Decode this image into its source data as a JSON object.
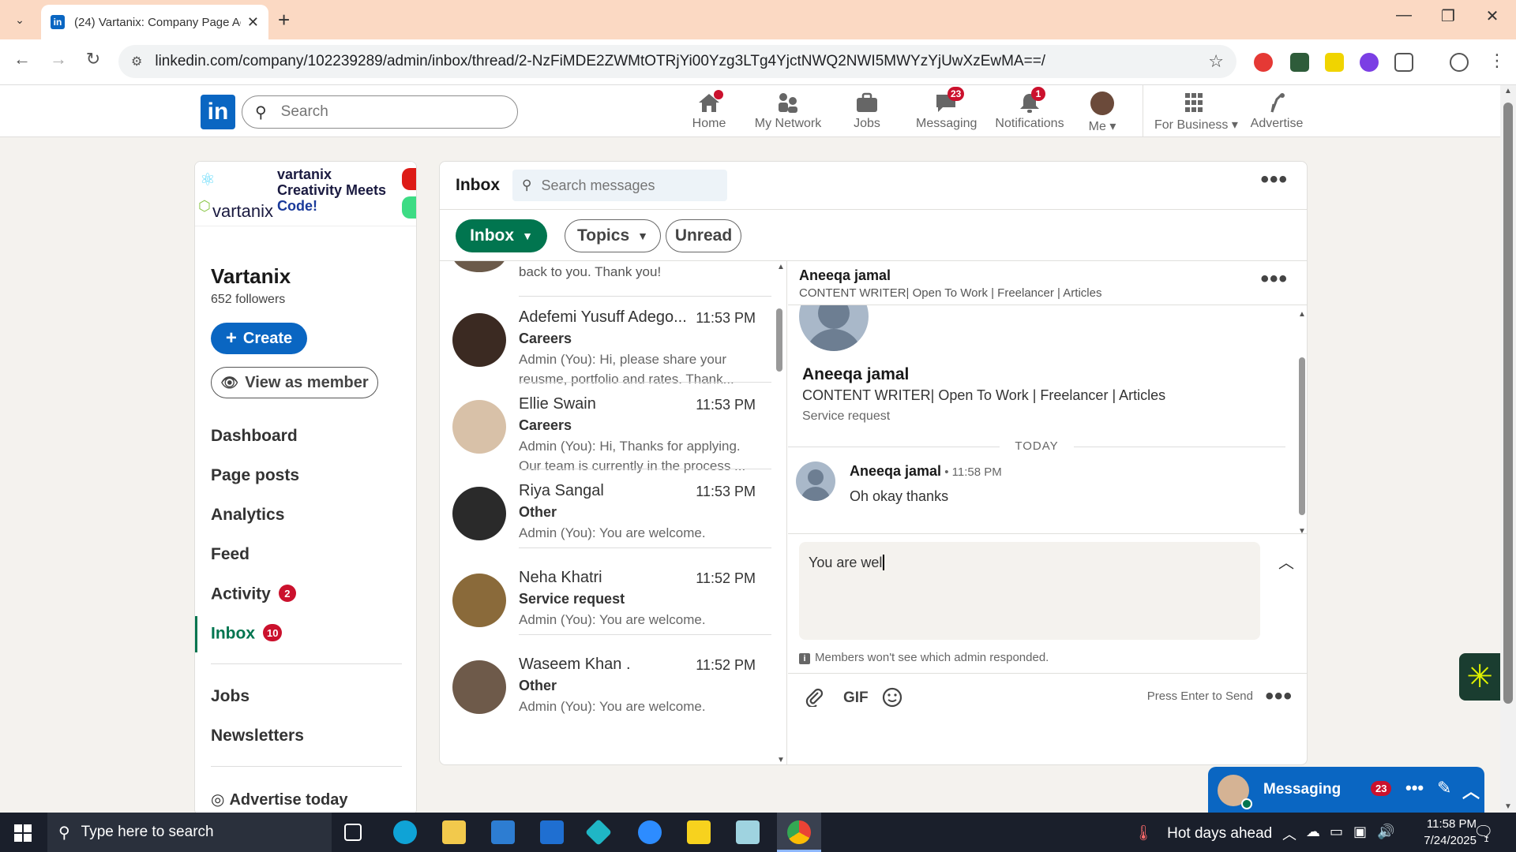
{
  "browser": {
    "tab_title": "(24) Vartanix: Company Page Ac",
    "url": "linkedin.com/company/102239289/admin/inbox/thread/2-NzFiMDE2ZWMtOTRjYi00Yzg3LTg4YjctNWQ2NWI5MWYzYjUwXzEwMA==/"
  },
  "li_nav": {
    "search_placeholder": "Search",
    "items": [
      {
        "label": "Home",
        "badge": ""
      },
      {
        "label": "My Network",
        "badge": ""
      },
      {
        "label": "Jobs",
        "badge": ""
      },
      {
        "label": "Messaging",
        "badge": "23"
      },
      {
        "label": "Notifications",
        "badge": "1"
      },
      {
        "label": "Me",
        "badge": ""
      },
      {
        "label": "For Business",
        "badge": ""
      },
      {
        "label": "Advertise",
        "badge": ""
      }
    ]
  },
  "page": {
    "cover_text_line1": "vartanix",
    "cover_text_line2": "Creativity Meets",
    "cover_text_line3": "Code!",
    "cover_logo": "vartanix",
    "name": "Vartanix",
    "followers": "652 followers",
    "create_label": "Create",
    "view_as_member_label": "View as member",
    "nav": {
      "dashboard": "Dashboard",
      "page_posts": "Page posts",
      "analytics": "Analytics",
      "feed": "Feed",
      "activity": "Activity",
      "activity_badge": "2",
      "inbox": "Inbox",
      "inbox_badge": "10",
      "jobs": "Jobs",
      "newsletters": "Newsletters",
      "advertise_today": "Advertise today"
    }
  },
  "inbox": {
    "title": "Inbox",
    "search_placeholder": "Search messages",
    "filters": {
      "inbox": "Inbox",
      "topics": "Topics",
      "unread": "Unread"
    },
    "partial_preview": "back to you. Thank you!",
    "conversations": [
      {
        "name": "Adefemi Yusuff Adego...",
        "time": "11:53 PM",
        "topic": "Careers",
        "preview": "Admin (You): Hi, please share your reusme, portfolio and rates. Thank..."
      },
      {
        "name": "Ellie Swain",
        "time": "11:53 PM",
        "topic": "Careers",
        "preview": "Admin (You): Hi, Thanks for applying. Our team is currently in the process ..."
      },
      {
        "name": "Riya Sangal",
        "time": "11:53 PM",
        "topic": "Other",
        "preview": "Admin (You): You are welcome."
      },
      {
        "name": "Neha Khatri",
        "time": "11:52 PM",
        "topic": "Service request",
        "preview": "Admin (You): You are welcome."
      },
      {
        "name": "Waseem Khan .",
        "time": "11:52 PM",
        "topic": "Other",
        "preview": "Admin (You): You are welcome."
      }
    ]
  },
  "thread": {
    "header_name": "Aneeqa jamal",
    "header_headline": "CONTENT WRITER| Open To Work | Freelancer | Articles",
    "profile_name": "Aneeqa jamal",
    "profile_headline": "CONTENT WRITER| Open To Work | Freelancer | Articles",
    "profile_topic": "Service request",
    "day_label": "TODAY",
    "message": {
      "sender": "Aneeqa jamal",
      "time": " • 11:58 PM",
      "text": "Oh okay thanks"
    },
    "composer_text": "You are wel",
    "notice": "Members won't see which admin responded.",
    "gif_label": "GIF",
    "press_enter": "Press Enter to Send"
  },
  "messaging_bubble": {
    "title": "Messaging",
    "badge": "23"
  },
  "taskbar": {
    "search_placeholder": "Type here to search",
    "weather": "Hot days ahead",
    "time": "11:58 PM",
    "date": "7/24/2025",
    "notif_count": "1"
  }
}
